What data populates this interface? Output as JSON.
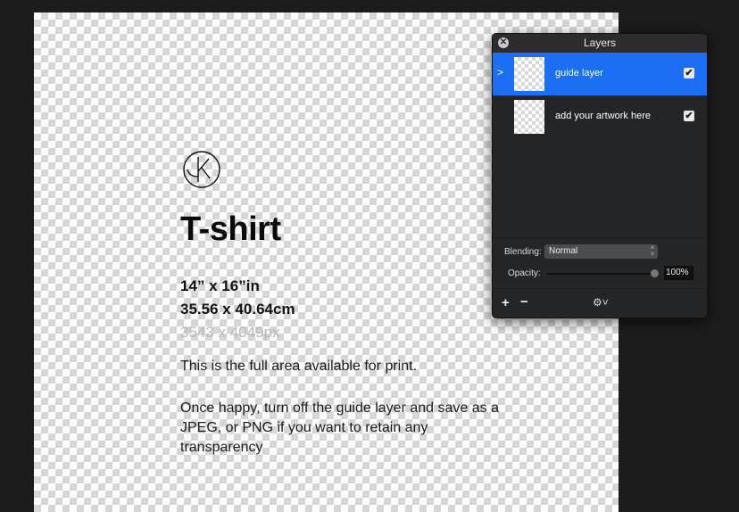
{
  "canvas": {
    "logo": "circled-k-logo",
    "title": "T-shirt",
    "dimensions_in": "14” x 16”in",
    "dimensions_cm": "35.56 x 40.64cm",
    "dimensions_px": "3543 x 4049px",
    "description": "This is the full area available for print.",
    "instructions": "Once happy, turn off the guide layer and save as a JPEG, or PNG if you want to retain any transparency"
  },
  "layers_panel": {
    "title": "Layers",
    "close_icon": "✕",
    "layers": [
      {
        "name": "guide layer",
        "visible": true,
        "selected": true,
        "expand_icon": ">"
      },
      {
        "name": "add your artwork here",
        "visible": true,
        "selected": false
      }
    ],
    "checkmark": "✔",
    "blending_label": "Blending:",
    "blending_value": "Normal",
    "opacity_label": "Opacity:",
    "opacity_value": "100%",
    "opacity_fraction": 1.0,
    "add_label": "+",
    "remove_label": "−",
    "gear_label": "⚙˅",
    "select_arrows": "˄˅"
  }
}
